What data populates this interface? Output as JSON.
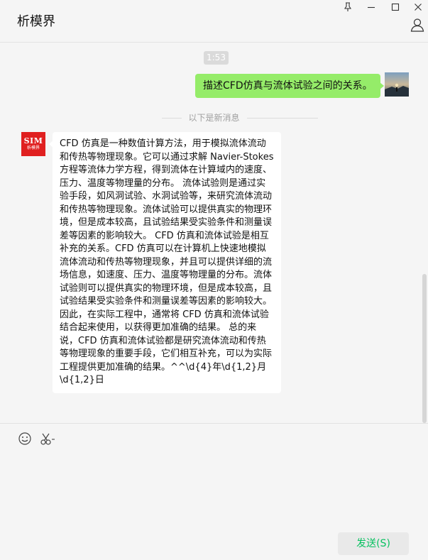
{
  "window": {
    "title": "析模界",
    "controls": [
      "pin-icon",
      "minimize-icon",
      "maximize-icon",
      "close-icon"
    ]
  },
  "header": {
    "user_icon": "user-icon"
  },
  "chat": {
    "time_badge": "1:53",
    "outgoing": {
      "text": "描述CFD仿真与流体试验之间的关系。",
      "bubble_color": "#95ec69"
    },
    "divider_text": "以下是新消息",
    "incoming": {
      "avatar_logo": "SIM",
      "avatar_sub": "析模界",
      "avatar_color": "#e02020",
      "text": "CFD 仿真是一种数值计算方法，用于模拟流体流动和传热等物理现象。它可以通过求解 Navier-Stokes 方程等流体力学方程，得到流体在计算域内的速度、压力、温度等物理量的分布。 流体试验则是通过实验手段，如风洞试验、水洞试验等，来研究流体流动和传热等物理现象。流体试验可以提供真实的物理环境，但是成本较高，且试验结果受实验条件和测量误差等因素的影响较大。 CFD 仿真和流体试验是相互补充的关系。CFD 仿真可以在计算机上快速地模拟流体流动和传热等物理现象，并且可以提供详细的流场信息，如速度、压力、温度等物理量的分布。流体试验则可以提供真实的物理环境，但是成本较高，且试验结果受实验条件和测量误差等因素的影响较大。因此，在实际工程中，通常将 CFD 仿真和流体试验结合起来使用，以获得更加准确的结果。 总的来说，CFD 仿真和流体试验都是研究流体流动和传热等物理现象的重要手段，它们相互补充，可以为实际工程提供更加准确的结果。^^\\d{4}年\\d{1,2}月\\d{1,2}日"
    }
  },
  "composer": {
    "tools": [
      "emoji-icon",
      "scissors-icon"
    ],
    "input_value": "",
    "send_label": "发送(S)",
    "send_color": "#07c160"
  }
}
